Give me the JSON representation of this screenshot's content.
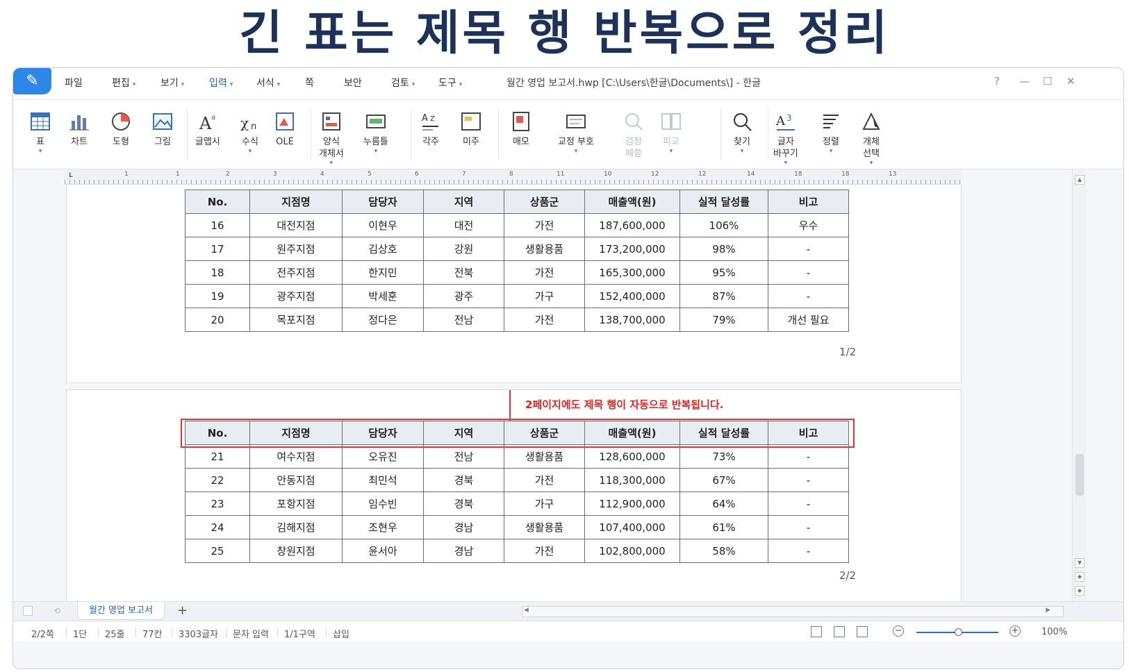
{
  "headline": "긴 표는 제목 행 반복으로 정리",
  "menu": [
    {
      "label": "파일",
      "caret": false
    },
    {
      "label": "편집",
      "caret": true
    },
    {
      "label": "보기",
      "caret": true
    },
    {
      "label": "입력",
      "caret": true,
      "active": true
    },
    {
      "label": "서식",
      "caret": true
    },
    {
      "label": "쪽",
      "caret": false
    },
    {
      "label": "보안",
      "caret": false
    },
    {
      "label": "검토",
      "caret": true
    },
    {
      "label": "도구",
      "caret": true
    }
  ],
  "window_title": "월간 영업 보고서.hwp [C:\\Users\\한글\\Documents\\] - 한글",
  "window_controls": {
    "help": "?",
    "minimize": "—",
    "maximize": "☐",
    "close": "✕"
  },
  "ribbon": [
    {
      "label": "표",
      "icon": "table-icon"
    },
    {
      "label": "차트",
      "icon": "chart-icon"
    },
    {
      "label": "도형",
      "icon": "shape-icon"
    },
    {
      "label": "그림",
      "icon": "picture-icon"
    },
    {
      "label": "글맵시",
      "icon": "text-art-icon"
    },
    {
      "label": "수식",
      "icon": "equation-icon"
    },
    {
      "label": "OLE",
      "icon": "ole-icon"
    },
    {
      "label": "양식\n개체서",
      "icon": "form-object-icon"
    },
    {
      "label": "누름틀",
      "icon": "field-icon"
    },
    {
      "label": "각주",
      "icon": "footnote-icon"
    },
    {
      "label": "미주",
      "icon": "endnote-icon"
    },
    {
      "label": "매모",
      "icon": "memo-icon"
    },
    {
      "label": "교정 부호",
      "icon": "proofreading-icon"
    },
    {
      "label": "검정\n폐쫑",
      "icon": "check-icon",
      "disabled": true
    },
    {
      "label": "피교",
      "icon": "compare-icon",
      "disabled": true
    },
    {
      "label": "찾기",
      "icon": "find-icon"
    },
    {
      "label": "글자\n바꾸기",
      "icon": "replace-icon"
    },
    {
      "label": "정렬",
      "icon": "sort-icon"
    },
    {
      "label": "개체\n선택",
      "icon": "select-object-icon"
    }
  ],
  "ruler_marks": [
    "1",
    "1",
    "2",
    "3",
    "4",
    "5",
    "6",
    "7",
    "8",
    "11",
    "10",
    "12",
    "12",
    "14",
    "18",
    "18",
    "13"
  ],
  "ruler_corner": "L",
  "table_headers": [
    "No.",
    "지점명",
    "담당자",
    "지역",
    "상품군",
    "매출액(원)",
    "실적 달성률",
    "비고"
  ],
  "page1_rows": [
    [
      "16",
      "대전지점",
      "이현우",
      "대전",
      "가전",
      "187,600,000",
      "106%",
      "우수"
    ],
    [
      "17",
      "원주지점",
      "김상호",
      "강원",
      "생활용품",
      "173,200,000",
      "98%",
      "-"
    ],
    [
      "18",
      "전주지점",
      "한지민",
      "전북",
      "가전",
      "165,300,000",
      "95%",
      "-"
    ],
    [
      "19",
      "광주지점",
      "박세훈",
      "광주",
      "가구",
      "152,400,000",
      "87%",
      "-"
    ],
    [
      "20",
      "목포지점",
      "정다은",
      "전남",
      "가전",
      "138,700,000",
      "79%",
      "개선 필요"
    ]
  ],
  "page1_number": "1/2",
  "annotation": "2페이지에도 제목 행이 자동으로 반복됩니다.",
  "page2_rows": [
    [
      "21",
      "여수지점",
      "오유진",
      "전남",
      "생활용품",
      "128,600,000",
      "73%",
      "-"
    ],
    [
      "22",
      "안동지점",
      "최민석",
      "경북",
      "가전",
      "118,300,000",
      "67%",
      "-"
    ],
    [
      "23",
      "포항지점",
      "임수빈",
      "경북",
      "가구",
      "112,900,000",
      "64%",
      "-"
    ],
    [
      "24",
      "김해지점",
      "조현우",
      "경남",
      "생활용품",
      "107,400,000",
      "61%",
      "-"
    ],
    [
      "25",
      "창원지점",
      "윤서아",
      "경남",
      "가전",
      "102,800,000",
      "58%",
      "-"
    ]
  ],
  "page2_number": "2/2",
  "doc_tab": "월간 영업 보고서",
  "tab_add": "+",
  "status": [
    "2/2쪽",
    "1단",
    "25줄",
    "77칸",
    "3303글자",
    "문자 입력",
    "1/1구역",
    "삽입"
  ],
  "zoom": "100%",
  "colors": {
    "accent": "#2e86e6",
    "highlight": "#e23434",
    "header_bg": "#e8edf3",
    "headline": "#1c3258"
  }
}
